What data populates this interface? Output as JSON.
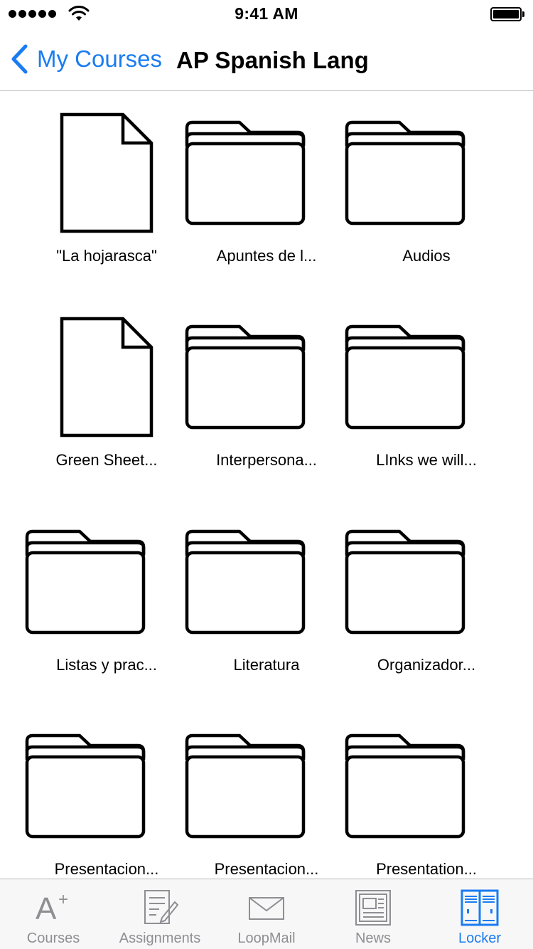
{
  "status_bar": {
    "time": "9:41 AM",
    "signal_icon": "cellular-signal-icon",
    "wifi_icon": "wifi-icon",
    "battery_icon": "battery-icon",
    "battery_level": 1.0
  },
  "nav": {
    "back_label": "My Courses",
    "back_icon": "chevron-left-icon",
    "title": "AP Spanish Lang"
  },
  "locker_items": [
    {
      "name": "\"La hojarasca\"",
      "kind": "file"
    },
    {
      "name": "Apuntes de l...",
      "kind": "folder"
    },
    {
      "name": "Audios",
      "kind": "folder"
    },
    {
      "name": "Green Sheet...",
      "kind": "file"
    },
    {
      "name": "Interpersona...",
      "kind": "folder"
    },
    {
      "name": "LInks we will...",
      "kind": "folder"
    },
    {
      "name": "Listas y prac...",
      "kind": "folder"
    },
    {
      "name": "Literatura",
      "kind": "folder"
    },
    {
      "name": "Organizador...",
      "kind": "folder"
    },
    {
      "name": "Presentacion...",
      "kind": "folder"
    },
    {
      "name": "Presentacion...",
      "kind": "folder"
    },
    {
      "name": "Presentation...",
      "kind": "folder"
    }
  ],
  "tabs": [
    {
      "label": "Courses",
      "icon": "a-plus-icon",
      "active": false
    },
    {
      "label": "Assignments",
      "icon": "assignment-edit-icon",
      "active": false
    },
    {
      "label": "LoopMail",
      "icon": "envelope-icon",
      "active": false
    },
    {
      "label": "News",
      "icon": "newspaper-icon",
      "active": false
    },
    {
      "label": "Locker",
      "icon": "locker-icon",
      "active": true
    }
  ],
  "colors": {
    "accent": "#1a7cf2",
    "inactive": "#8e8e93",
    "tab_bar_bg": "#f7f7f7",
    "separator": "#c8c7cc"
  }
}
